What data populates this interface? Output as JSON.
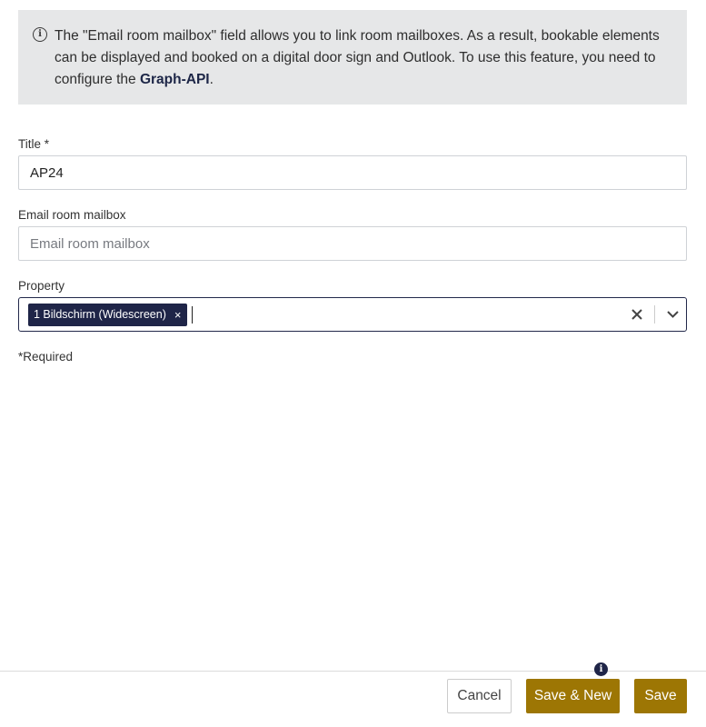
{
  "info": {
    "text_before": "The \"Email room mailbox\" field allows you to link room mailboxes. As a result, bookable elements can be displayed and booked on a digital door sign and Outlook. To use this feature, you need to configure the ",
    "link_text": "Graph-API",
    "text_after": "."
  },
  "form": {
    "title_label": "Title *",
    "title_value": "AP24",
    "email_label": "Email room mailbox",
    "email_placeholder": "Email room mailbox",
    "email_value": "",
    "property_label": "Property",
    "property_chips": [
      "1 Bildschirm (Widescreen)"
    ],
    "chip_remove": "×",
    "clear_symbol": "✕",
    "required_note": "*Required"
  },
  "footer": {
    "cancel_label": "Cancel",
    "save_new_label": "Save & New",
    "save_label": "Save",
    "hint_symbol": "i"
  },
  "colors": {
    "accent": "#9d7604",
    "navy": "#1f2548",
    "info_bg": "#e6e7e8"
  }
}
